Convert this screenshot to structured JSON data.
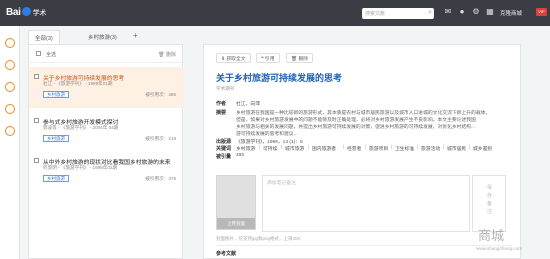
{
  "topbar": {
    "logo_brand": "Bai",
    "logo_brand2": "du",
    "logo_product": "学术",
    "search_placeholder": "搜索文献",
    "user_name": "克隆商城",
    "vip_badge": "VIP",
    "icons": [
      "search-icon",
      "bell-icon",
      "gear-icon",
      "grid-icon"
    ]
  },
  "tabs": [
    {
      "label": "全部(3)"
    },
    {
      "label": "乡村旅游(3)"
    }
  ],
  "tab_add_label": "+",
  "list": {
    "select_all": "全选",
    "delete_label": "删除",
    "items": [
      {
        "title": "关于乡村旅游可持续发展的思考",
        "meta": "杜江 - 《旅游学刊》 - 1999年01期",
        "tag": "乡村旅游",
        "cite": "被引用次：486",
        "selected": true
      },
      {
        "title": "参与式乡村旅游开发模式探讨",
        "meta": "郭凌等 - 《旅游学刊》 - 2004年 04期",
        "tag": "乡村旅游",
        "cite": "被引用次：218",
        "selected": false
      },
      {
        "title": "从中外乡村旅游的现状对比看我国乡村旅游的未来",
        "meta": "何景明 - 《旅游学刊》 - 1999年02期",
        "tag": "乡村旅游",
        "cite": "被引用次：376",
        "selected": false
      }
    ]
  },
  "detail": {
    "actions": [
      "获取全文",
      "引用",
      "删除"
    ],
    "title": "关于乡村旅游可持续发展的思考",
    "subtitle": "学术期刊",
    "author_label": "作者",
    "authors": "杜江，向萍",
    "abstract_label": "摘要",
    "abstract_lines": [
      "乡村旅游在我国是一种比较新的旅游形式，其本质是农村与城市居民旅游以及城市人口进城的文化交流下新上升的载体。",
      "但是，如果对乡村旅游发展中的问题不能够及时正确处理，必将对乡村旅游发展产生不良影响。本文主要论述我国",
      "乡村旅游与相关的发展问题，并提出乡村旅游可持续发展的对策，促进乡村旅游的可持续发展，对优化乡村结构...",
      "游可持续发展的思考和建议..."
    ],
    "source_label": "出版源",
    "source": "《旅游学刊》，1999，14 (1)：5",
    "keywords_label": "关键词",
    "keywords": [
      "乡村旅游",
      "可持续",
      "城市旅游",
      "国内旅游者",
      "经营者",
      "旅游项目",
      "卫生标准",
      "旅游活动",
      "城市居民",
      "城乡差别"
    ],
    "cited_label": "被引量",
    "cited": "486",
    "cover_button": "上传封面",
    "note_placeholder": "添加笔记备注",
    "save_label": "保存备注",
    "note_hint": "封面图片，仅支持jpg和png格式，上限30K",
    "refs_label": "参考文献"
  },
  "watermark": {
    "big": "商城",
    "small": "www.shangcheng.com"
  },
  "colors": {
    "topbar": "#3a3e44",
    "accent_orange": "#f08a24",
    "title_blue": "#1f5fb3",
    "selected_bg": "#fff0e4"
  }
}
